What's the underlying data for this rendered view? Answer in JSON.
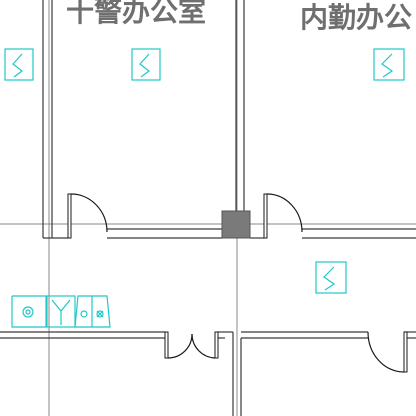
{
  "rooms": [
    {
      "id": "room-left-top",
      "label": "十警办公室"
    },
    {
      "id": "room-right-top",
      "label": "内勤办公"
    }
  ],
  "symbols": {
    "air_outlet": "air-outlet-icon",
    "toilet_group": "sanitary-fixtures-icon"
  },
  "colors": {
    "wall": "#3a3a3a",
    "grid": "#8a8a8a",
    "mep": "#1ec8c8",
    "column": "#7a7a7a",
    "label": "#6f6f6f"
  }
}
